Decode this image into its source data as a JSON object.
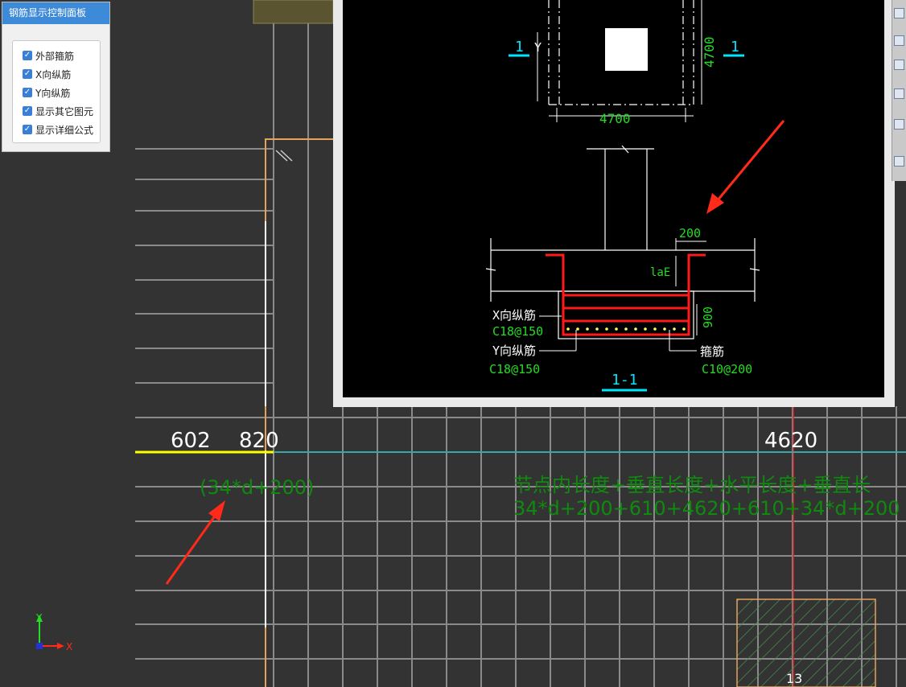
{
  "panel": {
    "title": "钢筋显示控制面板",
    "options": [
      {
        "label": "外部箍筋",
        "checked": true
      },
      {
        "label": "X向纵筋",
        "checked": true
      },
      {
        "label": "Y向纵筋",
        "checked": true
      },
      {
        "label": "显示其它图元",
        "checked": true
      },
      {
        "label": "显示详细公式",
        "checked": true
      }
    ]
  },
  "detail": {
    "section_label_left": "1",
    "section_label_right": "1",
    "y_marker": "Y",
    "dim_right": "4700",
    "dim_bottom": "4700",
    "dim_200": "200",
    "lae_label": "laE",
    "dim_900": "900",
    "x_rebar_label": "X向纵筋",
    "x_rebar_spec": "C18@150",
    "y_rebar_label": "Y向纵筋",
    "y_rebar_spec": "C18@150",
    "stirrup_label": "箍筋",
    "stirrup_spec": "C10@200",
    "section_title": "1-1"
  },
  "canvas": {
    "dim_602": "602",
    "dim_820": "820",
    "dim_4620": "4620",
    "formula_left": "(34*d+200)",
    "formula_line1": "节点内长度+垂直长度+水平长度+垂直长",
    "formula_line2": "34*d+200+610+4620+610+34*d+200",
    "axis_number": "13",
    "axis_x_label": "X",
    "axis_y_label": "Y"
  },
  "colors": {
    "background": "#333333",
    "grid": "#8a8a8a",
    "dimension_white": "#ffffff",
    "yellow_line": "#ffff00",
    "cyan_line": "#3aa7a7",
    "formula_green": "#0f8a0f",
    "rebar_red": "#ff1a1a",
    "arrow_red": "#ff2a1a",
    "cad_green": "#22dd22",
    "cad_cyan": "#00e5ff",
    "orange_outline": "#e5a25c"
  }
}
